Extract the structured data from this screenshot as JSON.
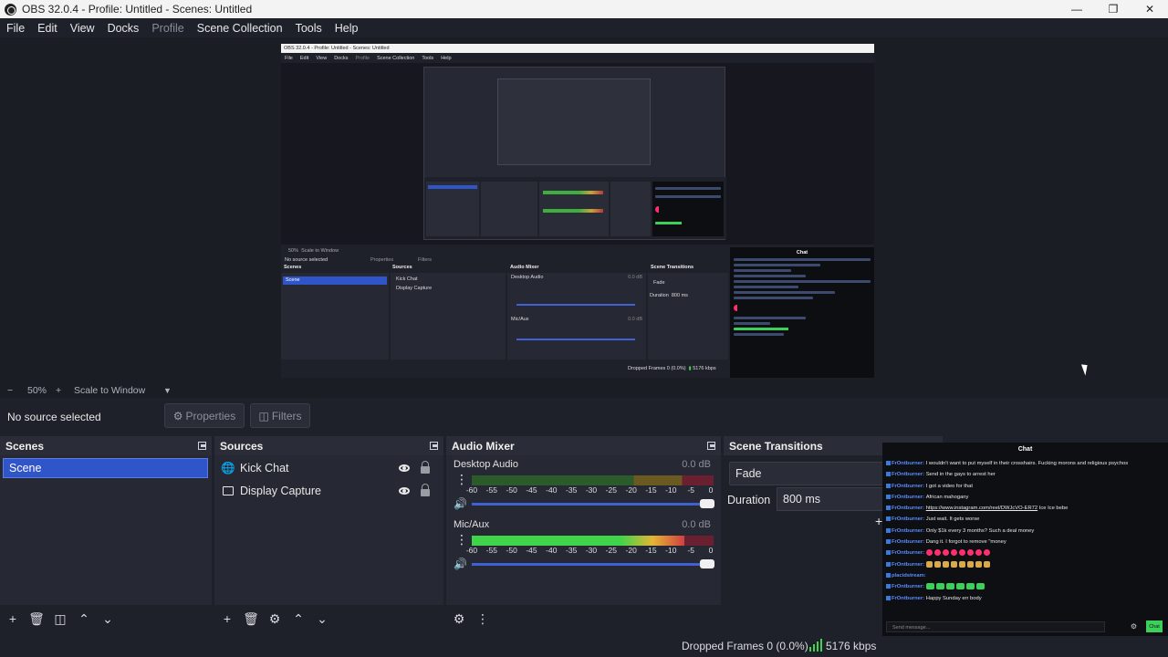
{
  "window": {
    "title": "OBS 32.0.4 - Profile: Untitled - Scenes: Untitled",
    "controls": [
      "minimize-icon",
      "restore-icon",
      "close-icon"
    ]
  },
  "menu": {
    "file": "File",
    "edit": "Edit",
    "view": "View",
    "docks": "Docks",
    "profile": "Profile",
    "scene_collection": "Scene Collection",
    "tools": "Tools",
    "help": "Help"
  },
  "preview": {
    "nested_title": "OBS 32.0.4 - Profile: Untitled - Scenes: Untitled",
    "nested_menu": [
      "File",
      "Edit",
      "View",
      "Docks",
      "Profile",
      "Scene Collection",
      "Tools",
      "Help"
    ],
    "nested_zoom": "50%",
    "nested_scale": "Scale to Window",
    "nested_no_source": "No source selected",
    "nested_properties": "Properties",
    "nested_filters": "Filters",
    "nested_scenes": "Scenes",
    "nested_sources": "Sources",
    "nested_mixer": "Audio Mixer",
    "nested_transitions": "Scene Transitions",
    "nested_scene_item": "Scene",
    "nested_src1": "Kick Chat",
    "nested_src2": "Display Capture",
    "nested_ch1": "Desktop Audio",
    "nested_ch2": "Mic/Aux",
    "nested_db": "0.0 dB",
    "nested_fade": "Fade",
    "nested_duration": "Duration",
    "nested_duration_val": "800 ms",
    "nested_chat": "Chat",
    "nested_status": "Dropped Frames 0 (0.0%)",
    "nested_kbps": "5176 kbps"
  },
  "zoom": {
    "minus": "−",
    "value": "50%",
    "plus": "+",
    "scale_mode": "Scale to Window"
  },
  "selection": {
    "no_source": "No source selected",
    "properties": "Properties",
    "filters": "Filters"
  },
  "scenes": {
    "title": "Scenes",
    "items": [
      "Scene"
    ]
  },
  "sources": {
    "title": "Sources",
    "items": [
      {
        "label": "Kick Chat",
        "icon": "browser-source-icon"
      },
      {
        "label": "Display Capture",
        "icon": "monitor-icon"
      }
    ]
  },
  "mixer": {
    "title": "Audio Mixer",
    "channels": [
      {
        "name": "Desktop Audio",
        "db": "0.0 dB",
        "level": 0.0,
        "volume": 1.0
      },
      {
        "name": "Mic/Aux",
        "db": "0.0 dB",
        "level": 0.88,
        "volume": 1.0
      }
    ],
    "ticks": [
      "-60",
      "-55",
      "-50",
      "-45",
      "-40",
      "-35",
      "-30",
      "-25",
      "-20",
      "-15",
      "-10",
      "-5",
      "0"
    ]
  },
  "transitions": {
    "title": "Scene Transitions",
    "selected": "Fade",
    "duration_label": "Duration",
    "duration_value": "800 ms"
  },
  "chat": {
    "title": "Chat",
    "messages": [
      {
        "user": "FrOntburner",
        "text": "I wouldn't want to put myself in their crosshairs. Fucking morons and religious psychos"
      },
      {
        "user": "FrOntburner",
        "text": "Send in the gays to arrest her"
      },
      {
        "user": "FrOntburner",
        "text": "I got a video for that"
      },
      {
        "user": "FrOntburner",
        "text": "African mahogany"
      },
      {
        "user": "FrOntburner",
        "text": "https://www.instagram.com/reel/DWJcVO-ER72 Ice Ice bebe",
        "link": "https://www.instagram.com/reel/DWJcVO-ER72"
      },
      {
        "user": "FrOntburner",
        "text": "Just wait. It gets worse"
      },
      {
        "user": "FrOntburner",
        "text": "Only $1k every 3 months? Such a deal money"
      },
      {
        "user": "FrOntburner",
        "text": "Dang it. I forgot to remove \"money"
      },
      {
        "user": "FrOntburner",
        "text": "",
        "emotes": "red-circles"
      },
      {
        "user": "FrOntburner",
        "text": "",
        "emotes": "cats"
      },
      {
        "user": "placidstream",
        "text": ""
      },
      {
        "user": "FrOntburner",
        "text": "",
        "emotes": "green"
      },
      {
        "user": "FrOntburner",
        "text": "Happy Sunday err body"
      }
    ],
    "input_placeholder": "Send message...",
    "send_label": "Chat"
  },
  "status": {
    "dropped": "Dropped Frames 0 (0.0%)",
    "kbps": "5176 kbps"
  }
}
